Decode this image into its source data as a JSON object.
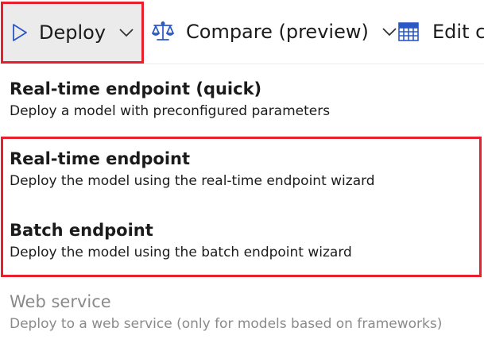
{
  "toolbar": {
    "deploy": {
      "label": "Deploy",
      "icon": "play-icon",
      "chevron": "chevron-down-icon"
    },
    "compare": {
      "label": "Compare (preview)",
      "icon": "scales-icon",
      "chevron": "chevron-down-icon"
    },
    "edit": {
      "label": "Edit co",
      "icon": "table-edit-icon"
    }
  },
  "menu": {
    "items": [
      {
        "title": "Real-time endpoint (quick)",
        "description": "Deploy a model with preconfigured parameters",
        "enabled": true
      },
      {
        "title": "Real-time endpoint",
        "description": "Deploy the model using the real-time endpoint wizard",
        "enabled": true
      },
      {
        "title": "Batch endpoint",
        "description": "Deploy the model using the batch endpoint wizard",
        "enabled": true
      },
      {
        "title": "Web service",
        "description": "Deploy to a web service (only for models based on frameworks)",
        "enabled": false
      }
    ]
  },
  "colors": {
    "accent": "#2b58c7",
    "highlight": "#e8202e",
    "disabled_text": "#8a8a8a",
    "selected_bg": "#ebebeb"
  }
}
